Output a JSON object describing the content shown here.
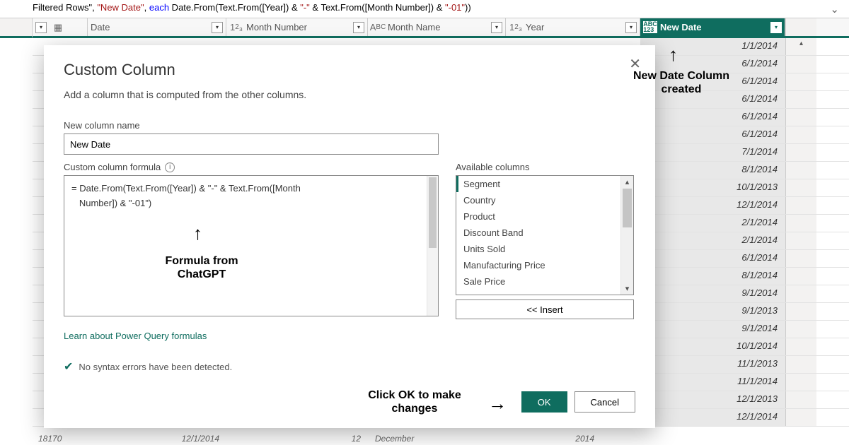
{
  "formula_bar": {
    "pre": "Filtered Rows\", ",
    "colname": "\"New Date\"",
    "sep": ", ",
    "each": "each",
    "func_open": " Date.From(Text.From([Year]) & ",
    "dash1": "\"-\"",
    "mid": " & Text.From([Month Number]) & ",
    "dash2": "\"-01\"",
    "close": "))"
  },
  "columns": {
    "index_type": "",
    "date_label": "Date",
    "monthnum_label": "Month Number",
    "monthnum_type": "1²₃",
    "monthname_label": "Month Name",
    "monthname_type": "Aᴮc",
    "year_label": "Year",
    "year_type": "1²₃",
    "newdate_label": "New Date",
    "newdate_type": "ABC\n123"
  },
  "newdate_values": [
    "1/1/2014",
    "6/1/2014",
    "6/1/2014",
    "6/1/2014",
    "6/1/2014",
    "6/1/2014",
    "7/1/2014",
    "8/1/2014",
    "10/1/2013",
    "12/1/2014",
    "2/1/2014",
    "2/1/2014",
    "6/1/2014",
    "8/1/2014",
    "9/1/2014",
    "9/1/2013",
    "9/1/2014",
    "10/1/2014",
    "11/1/2013",
    "11/1/2014",
    "12/1/2013",
    "12/1/2014"
  ],
  "bottom_peek": {
    "id": "18170",
    "date": "12/1/2014",
    "monthnum": "12",
    "monthname": "December",
    "year": "2014"
  },
  "dialog": {
    "title": "Custom Column",
    "subtitle": "Add a column that is computed from the other columns.",
    "name_label": "New column name",
    "name_value": "New Date",
    "formula_label": "Custom column formula",
    "formula_text": "= Date.From(Text.From([Year]) & \"-\" & Text.From([Month\n   Number]) & \"-01\")",
    "available_label": "Available columns",
    "available_columns": [
      "Segment",
      "Country",
      "Product",
      "Discount Band",
      "Units Sold",
      "Manufacturing Price",
      "Sale Price"
    ],
    "insert_label": "<< Insert",
    "learn_link": "Learn about Power Query formulas",
    "status_text": "No syntax errors have been detected.",
    "ok_label": "OK",
    "cancel_label": "Cancel"
  },
  "annotations": {
    "newcol": "New Date Column\ncreated",
    "formula_anno": "Formula from\nChatGPT",
    "ok_anno": "Click OK to make\nchanges"
  }
}
